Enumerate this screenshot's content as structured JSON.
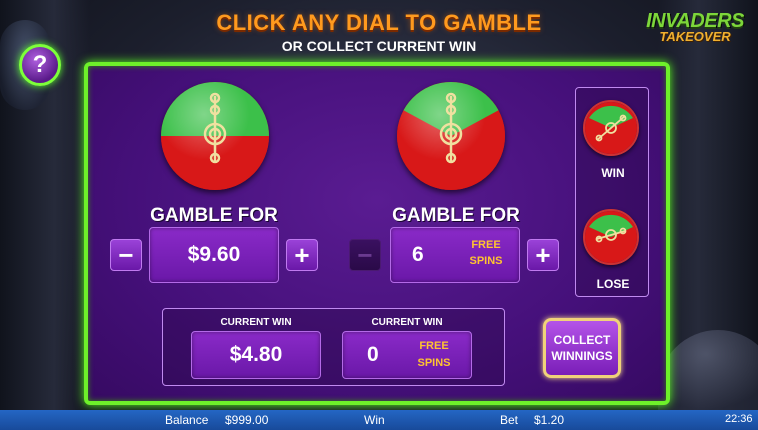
{
  "header": {
    "title": "CLICK ANY DIAL TO GAMBLE",
    "subtitle": "OR COLLECT CURRENT WIN",
    "help_symbol": "?",
    "logo_top": "INVADERS",
    "logo_bottom": "TAKEOVER"
  },
  "left_gamble": {
    "label": "GAMBLE FOR",
    "value": "$9.60",
    "minus": "−",
    "plus": "+",
    "minus_enabled": true
  },
  "right_gamble": {
    "label": "GAMBLE FOR",
    "value": "6",
    "unit_line1": "FREE",
    "unit_line2": "SPINS",
    "minus": "−",
    "plus": "+",
    "minus_enabled": false
  },
  "side_panel": {
    "win_label": "WIN",
    "lose_label": "LOSE"
  },
  "current_win": {
    "label_cash": "CURRENT WIN",
    "value_cash": "$4.80",
    "label_spins": "CURRENT WIN",
    "value_spins": "0",
    "spins_line1": "FREE",
    "spins_line2": "SPINS"
  },
  "collect_button": {
    "line1": "COLLECT",
    "line2": "WINNINGS"
  },
  "status_bar": {
    "balance_label": "Balance",
    "balance_value": "$999.00",
    "win_label": "Win",
    "bet_label": "Bet",
    "bet_value": "$1.20",
    "clock": "22:36"
  },
  "colors": {
    "panel_border": "#6ef02a",
    "dial_green": "#3cc04a",
    "dial_red": "#d81818",
    "title_orange": "#ff9a1e",
    "free_spins_gold": "#ffc430"
  },
  "icons": [
    "help-icon",
    "dial-needle-icon"
  ]
}
